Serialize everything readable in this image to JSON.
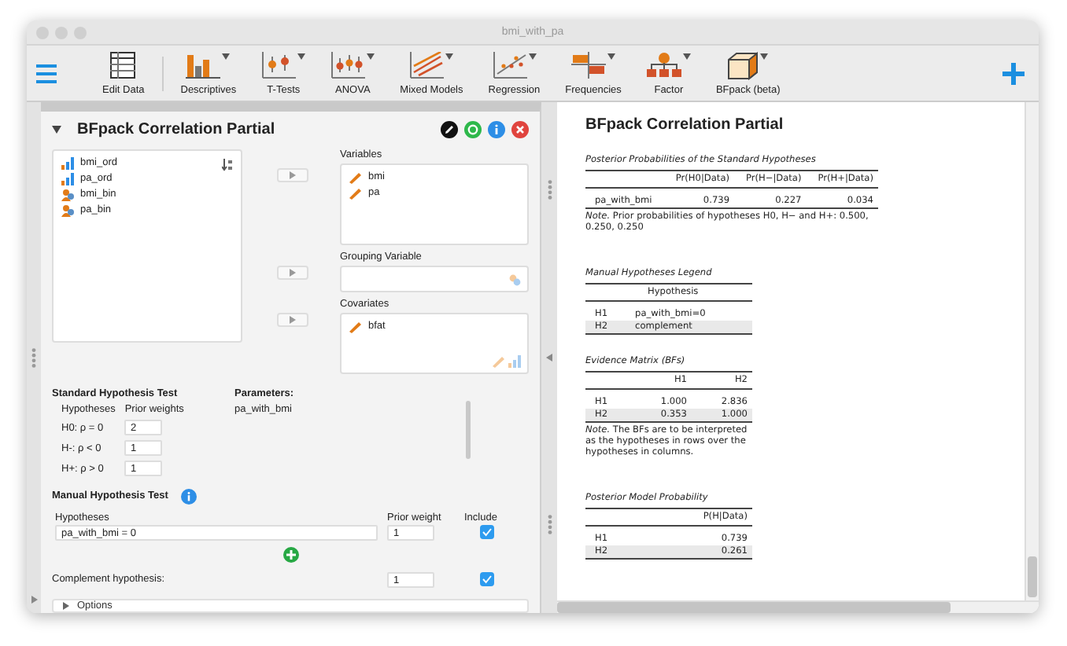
{
  "window": {
    "title": "bmi_with_pa"
  },
  "toolbar": {
    "items": [
      {
        "label": "Edit Data",
        "kind": "table",
        "has_menu": false
      },
      {
        "label": "Descriptives",
        "kind": "bars",
        "has_menu": true
      },
      {
        "label": "T-Tests",
        "kind": "ttest",
        "has_menu": true
      },
      {
        "label": "ANOVA",
        "kind": "anova",
        "has_menu": true
      },
      {
        "label": "Mixed Models",
        "kind": "mixed",
        "has_menu": true
      },
      {
        "label": "Regression",
        "kind": "regression",
        "has_menu": true
      },
      {
        "label": "Frequencies",
        "kind": "frequencies",
        "has_menu": true
      },
      {
        "label": "Factor",
        "kind": "factor",
        "has_menu": true
      },
      {
        "label": "BFpack (beta)",
        "kind": "cube",
        "has_menu": true
      }
    ]
  },
  "analysis": {
    "title": "BFpack Correlation Partial",
    "expanded": true,
    "variables": [
      {
        "name": "bmi_ord",
        "kind": "ordinal"
      },
      {
        "name": "pa_ord",
        "kind": "ordinal"
      },
      {
        "name": "bmi_bin",
        "kind": "nominal"
      },
      {
        "name": "pa_bin",
        "kind": "nominal"
      }
    ],
    "targets": [
      {
        "label": "Variables",
        "items": [
          {
            "name": "bmi",
            "kind": "scale"
          },
          {
            "name": "pa",
            "kind": "scale"
          }
        ]
      },
      {
        "label": "Grouping Variable"
      },
      {
        "label": "Covariates",
        "items": [
          {
            "name": "bfat",
            "kind": "scale"
          }
        ]
      }
    ],
    "standard_test": {
      "title": "Standard Hypothesis Test",
      "columns": [
        "Hypotheses",
        "Prior weights"
      ],
      "rows": [
        {
          "label": "H0: ρ = 0",
          "value": "2"
        },
        {
          "label": "H-: ρ < 0",
          "value": "1"
        },
        {
          "label": "H+: ρ > 0",
          "value": "1"
        }
      ]
    },
    "parameters": {
      "title": "Parameters:",
      "items": [
        "pa_with_bmi"
      ]
    },
    "manual_test": {
      "title": "Manual Hypothesis Test",
      "columns": [
        "Hypotheses",
        "Prior weight",
        "Include"
      ],
      "rows": [
        {
          "hypothesis": "pa_with_bmi = 0",
          "weight": "1",
          "include": true
        }
      ],
      "complement": {
        "label": "Complement hypothesis:",
        "weight": "1",
        "include": true
      }
    },
    "options": {
      "label": "Options",
      "expanded": false
    }
  },
  "output": {
    "title": "BFpack Correlation Partial",
    "tables": [
      {
        "title": "Posterior Probabilities of the Standard Hypotheses",
        "columns": [
          "",
          "Pr(H0|Data)",
          "Pr(H−|Data)",
          "Pr(H+|Data)"
        ],
        "rows": [
          [
            "pa_with_bmi",
            "0.739",
            "0.227",
            "0.034"
          ]
        ],
        "note": "*Note.* Prior probabilities of hypotheses H0, H− and H+: 0.500, 0.250, 0.250"
      },
      {
        "title": "Manual Hypotheses Legend",
        "columns": [
          "",
          "Hypothesis"
        ],
        "text_column": true,
        "rows": [
          [
            "H1",
            "pa_with_bmi=0"
          ],
          [
            "H2",
            "complement"
          ]
        ]
      },
      {
        "title": "Evidence Matrix (BFs)",
        "columns": [
          "",
          "H1",
          "H2"
        ],
        "rows": [
          [
            "H1",
            "1.000",
            "2.836"
          ],
          [
            "H2",
            "0.353",
            "1.000"
          ]
        ],
        "note": "*Note.* The BFs are to be interpreted as the hypotheses in rows over the hypotheses in columns."
      },
      {
        "title": "Posterior Model Probability",
        "columns": [
          "",
          "P(H|Data)"
        ],
        "rows": [
          [
            "H1",
            "0.739"
          ],
          [
            "H2",
            "0.261"
          ]
        ]
      }
    ]
  }
}
